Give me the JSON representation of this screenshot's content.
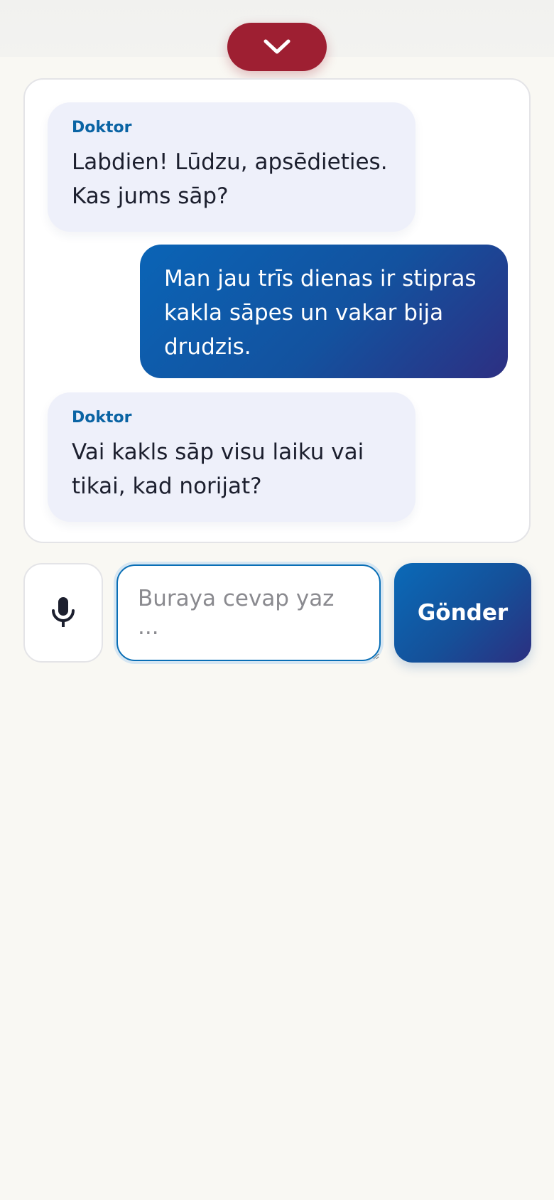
{
  "header": {
    "collapse_icon": "chevron-down-icon"
  },
  "colors": {
    "collapse_button": "#9e1f32",
    "doctor_bubble": "#eef0fa",
    "doctor_name": "#0a64a4",
    "patient_bubble_start": "#0a64b6",
    "patient_bubble_end": "#2d2f82",
    "page_background": "#f9f8f3"
  },
  "chat": {
    "messages": [
      {
        "role": "doctor",
        "sender": "Doktor",
        "lines": [
          "Labdien! Lūdzu, apsēdieties.",
          "Kas jums sāp?"
        ]
      },
      {
        "role": "patient",
        "sender": "",
        "lines": [
          "Man jau trīs dienas ir stipras",
          "kakla sāpes un vakar bija",
          "drudzis."
        ]
      },
      {
        "role": "doctor",
        "sender": "Doktor",
        "lines": [
          "Vai kakls sāp visu laiku vai",
          "tikai, kad norijat?"
        ]
      }
    ]
  },
  "composer": {
    "mic_icon": "microphone-icon",
    "placeholder": "Buraya cevap yaz ...",
    "value": "",
    "send_label": "Gönder"
  }
}
